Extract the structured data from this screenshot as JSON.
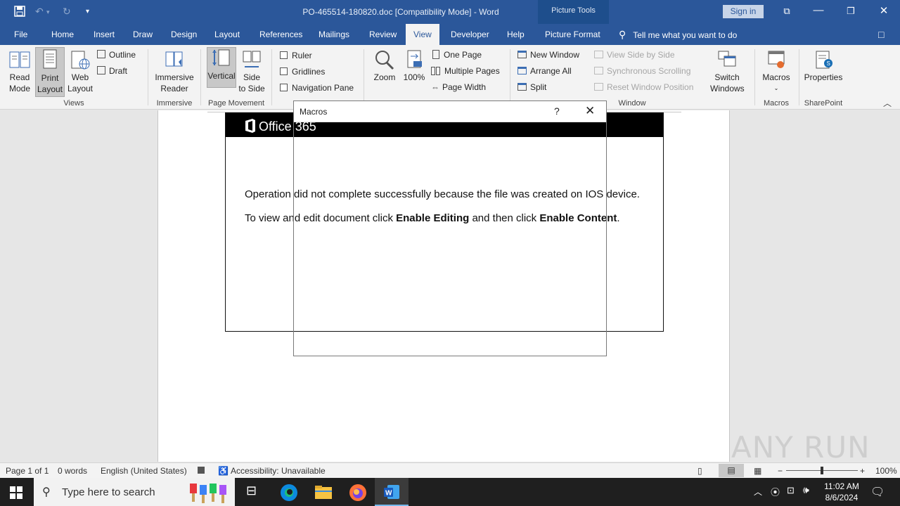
{
  "titlebar": {
    "doc_title": "PO-465514-180820.doc [Compatibility Mode] - Word",
    "picture_tools": "Picture Tools",
    "sign_in": "Sign in"
  },
  "tabs": {
    "file": "File",
    "home": "Home",
    "insert": "Insert",
    "draw": "Draw",
    "design": "Design",
    "layout": "Layout",
    "references": "References",
    "mailings": "Mailings",
    "review": "Review",
    "view": "View",
    "developer": "Developer",
    "help": "Help",
    "picture_format": "Picture Format",
    "tell_me": "Tell me what you want to do"
  },
  "ribbon": {
    "views": {
      "read_mode": [
        "Read",
        "Mode"
      ],
      "print_layout": [
        "Print",
        "Layout"
      ],
      "web_layout": [
        "Web",
        "Layout"
      ],
      "outline": "Outline",
      "draft": "Draft",
      "label": "Views"
    },
    "immersive": {
      "reader": [
        "Immersive",
        "Reader"
      ],
      "label": "Immersive"
    },
    "page_movement": {
      "vertical": "Vertical",
      "side_to_side": [
        "Side",
        "to Side"
      ],
      "label": "Page Movement"
    },
    "show": {
      "ruler": "Ruler",
      "gridlines": "Gridlines",
      "navigation_pane": "Navigation Pane"
    },
    "zoom": {
      "zoom": "Zoom",
      "hundred": "100%",
      "one_page": "One Page",
      "multiple_pages": "Multiple Pages",
      "page_width": "Page Width"
    },
    "window": {
      "new_window": "New Window",
      "arrange_all": "Arrange All",
      "split": "Split",
      "view_side_by_side": "View Side by Side",
      "sync_scrolling": "Synchronous Scrolling",
      "reset_position": "Reset Window Position",
      "switch_windows": [
        "Switch",
        "Windows"
      ],
      "label": "Window"
    },
    "macros": {
      "macros": "Macros",
      "label": "Macros"
    },
    "sharepoint": {
      "properties": "Properties",
      "label": "SharePoint"
    }
  },
  "document": {
    "logo_text": "Office 365",
    "line1": "Operation did not complete successfully because the file was created on IOS device.",
    "line2_a": "To view and edit document click ",
    "line2_b": "Enable Editing",
    "line2_c": " and then click ",
    "line2_d": "Enable Content",
    "line2_e": "."
  },
  "dialog": {
    "title": "Macros",
    "help": "?",
    "close": "✕"
  },
  "statusbar": {
    "page": "Page 1 of 1",
    "words": "0 words",
    "language": "English (United States)",
    "accessibility": "Accessibility: Unavailable",
    "zoom": "100%"
  },
  "taskbar": {
    "search_placeholder": "Type here to search",
    "time": "11:02 AM",
    "date": "8/6/2024"
  },
  "watermark": "ANY RUN"
}
